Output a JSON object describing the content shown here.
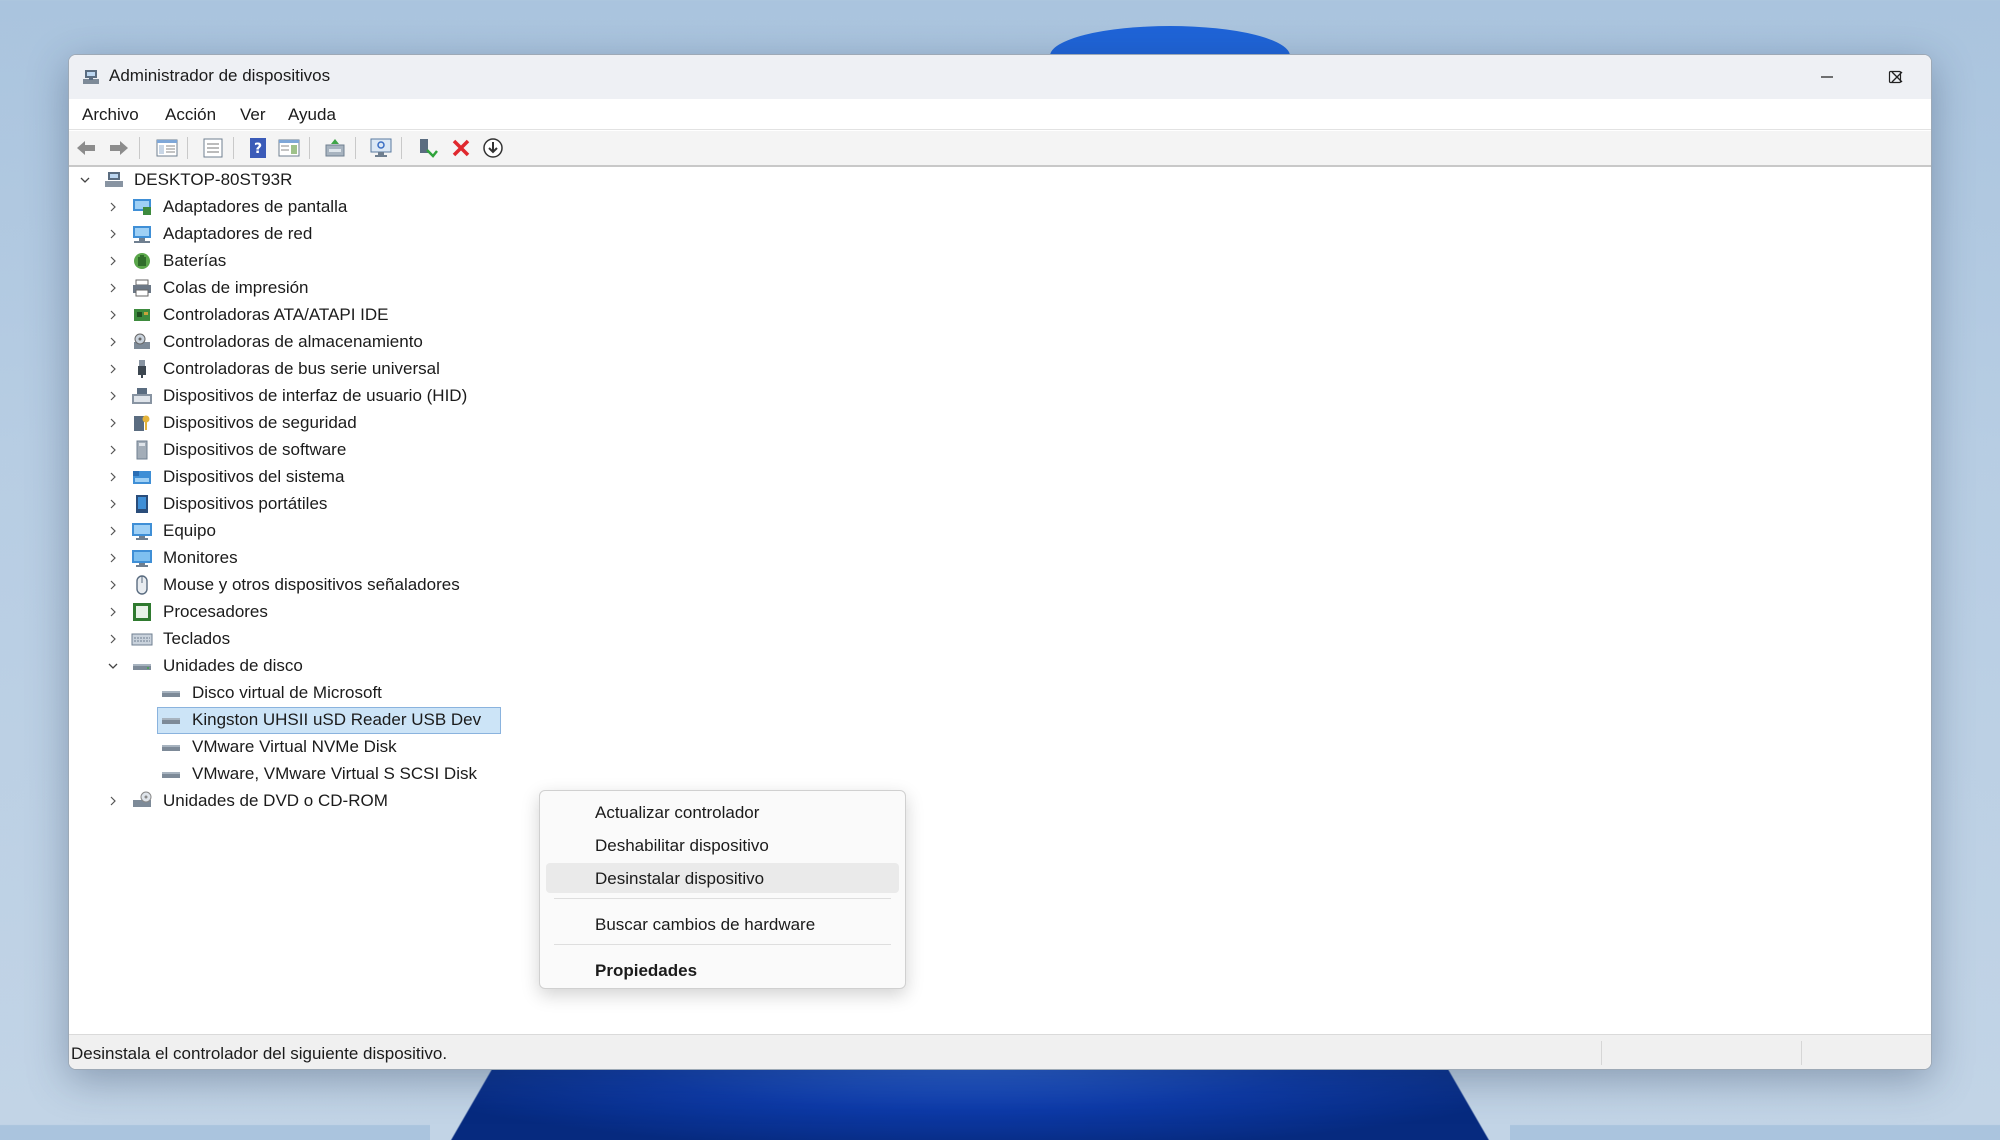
{
  "window": {
    "title": "Administrador de dispositivos",
    "controls": [
      "minimize-icon",
      "maximize-icon",
      "close-icon"
    ]
  },
  "menubar": {
    "items": [
      "Archivo",
      "Acción",
      "Ver",
      "Ayuda"
    ]
  },
  "toolbar": {
    "buttons": [
      "back-arrow-icon",
      "forward-arrow-icon",
      "show-hide-tree-icon",
      "properties-icon",
      "help-icon",
      "action-pane-icon",
      "update-driver-icon",
      "scan-hardware-icon",
      "enable-device-icon",
      "uninstall-device-icon",
      "disable-device-icon"
    ]
  },
  "tree": {
    "root": "DESKTOP-80ST93R",
    "categories": [
      "Adaptadores de pantalla",
      "Adaptadores de red",
      "Baterías",
      "Colas de impresión",
      "Controladoras ATA/ATAPI IDE",
      "Controladoras de almacenamiento",
      "Controladoras de bus serie universal",
      "Dispositivos de interfaz de usuario (HID)",
      "Dispositivos de seguridad",
      "Dispositivos de software",
      "Dispositivos del sistema",
      "Dispositivos portátiles",
      "Equipo",
      "Monitores",
      "Mouse y otros dispositivos señaladores",
      "Procesadores",
      "Teclados",
      "Unidades de disco"
    ],
    "disk_children": [
      "Disco virtual de Microsoft",
      "Kingston UHSII uSD Reader USB Dev",
      "VMware Virtual NVMe Disk",
      "VMware, VMware Virtual S SCSI Disk"
    ],
    "last_category": "Unidades de DVD o CD-ROM"
  },
  "context_menu": {
    "items": [
      "Actualizar controlador",
      "Deshabilitar dispositivo",
      "Desinstalar dispositivo",
      "Buscar cambios de hardware",
      "Propiedades"
    ]
  },
  "statusbar": {
    "text": "Desinstala el controlador del siguiente dispositivo."
  }
}
